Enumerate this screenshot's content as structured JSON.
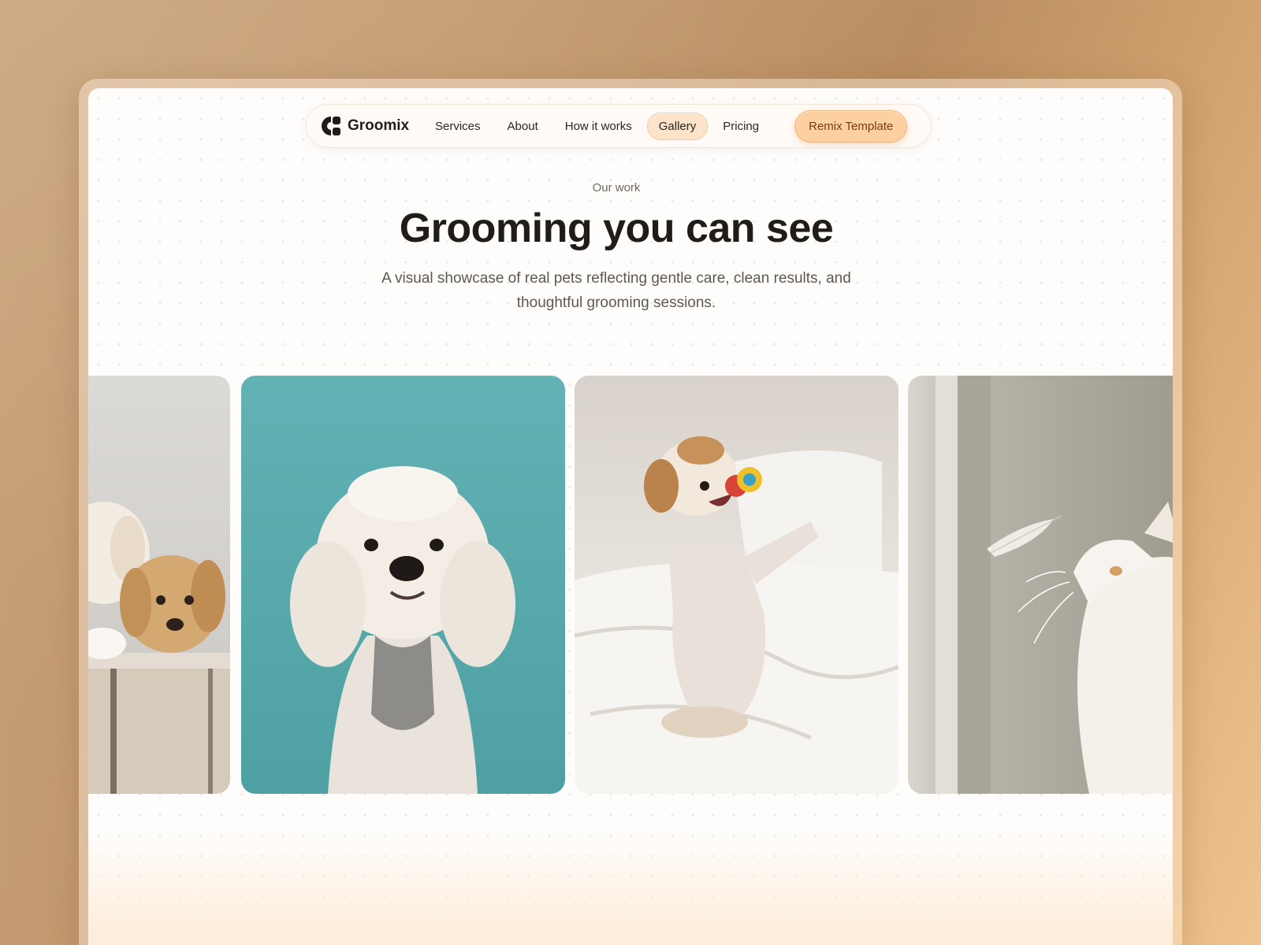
{
  "brand": {
    "name": "Groomix",
    "logo_icon": "groomix-logo-icon"
  },
  "nav": {
    "items": [
      {
        "label": "Services",
        "active": false
      },
      {
        "label": "About",
        "active": false
      },
      {
        "label": "How it works",
        "active": false
      },
      {
        "label": "Gallery",
        "active": true
      },
      {
        "label": "Pricing",
        "active": false
      }
    ],
    "cta_label": "Remix Template"
  },
  "section": {
    "eyebrow": "Our work",
    "title": "Grooming you can see",
    "subtitle_line1": "A visual showcase of real pets reflecting gentle care, clean results, and",
    "subtitle_line2": "thoughtful grooming sessions."
  },
  "gallery": [
    {
      "subject": "two-puppies-photo"
    },
    {
      "subject": "white-poodle-photo"
    },
    {
      "subject": "puppy-with-toy-photo"
    },
    {
      "subject": "white-cat-feather-photo"
    }
  ],
  "colors": {
    "accent": "#fdd0a2",
    "accent_text": "#7a3a10",
    "active_tab": "#fde3c9",
    "heading": "#1f1c1a"
  }
}
